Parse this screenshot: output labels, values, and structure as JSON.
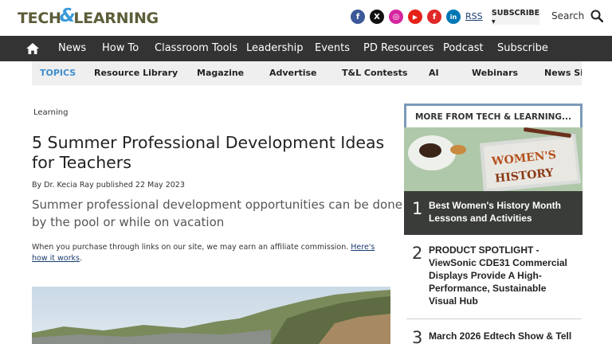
{
  "header": {
    "logo": {
      "part1": "TECH",
      "amp": "&",
      "part2": "LEARNING"
    },
    "social_icons": [
      {
        "name": "facebook-icon",
        "glyph": "f",
        "color": "#3b5998"
      },
      {
        "name": "x-icon",
        "glyph": "X",
        "color": "#111111"
      },
      {
        "name": "instagram-icon",
        "glyph": "◎",
        "color": "#d6249f"
      },
      {
        "name": "youtube-icon",
        "glyph": "▶",
        "color": "#e62117"
      },
      {
        "name": "flipboard-icon",
        "glyph": "f",
        "color": "#e12828"
      },
      {
        "name": "linkedin-icon",
        "glyph": "in",
        "color": "#0077b5"
      }
    ],
    "rss_label": "RSS",
    "subscribe_label": "SUBSCRIBE ▾",
    "search_label": "Search"
  },
  "main_nav": {
    "items": [
      "News",
      "How To",
      "Classroom Tools",
      "Leadership",
      "Events",
      "PD Resources",
      "Podcast",
      "Subscribe"
    ]
  },
  "topics_nav": {
    "lead": "TOPICS",
    "items": [
      "Resource Library",
      "Magazine",
      "Advertise",
      "T&L Contests",
      "AI",
      "Webinars",
      "News Sig"
    ]
  },
  "article": {
    "category": "Learning",
    "title": "5 Summer Professional Development Ideas for Teachers",
    "byline": "By Dr. Kecia Ray published 22 May 2023",
    "dek": "Summer professional development opportunities can be done by the pool or while on vacation",
    "affiliate_text": "When you purchase through links on our site, we may earn an affiliate commission. ",
    "affiliate_link": "Here's how it works",
    "affiliate_end": "."
  },
  "sidebar": {
    "heading": "MORE FROM TECH & LEARNING...",
    "items": [
      {
        "rank": "1",
        "title": "Best Women's History Month Lessons and Activities"
      },
      {
        "rank": "2",
        "title": "PRODUCT SPOTLIGHT - ViewSonic CDE31 Commercial Displays Provide A High-Performance, Sustainable Visual Hub"
      },
      {
        "rank": "3",
        "title": "March 2026 Edtech Show & Tell"
      }
    ]
  }
}
